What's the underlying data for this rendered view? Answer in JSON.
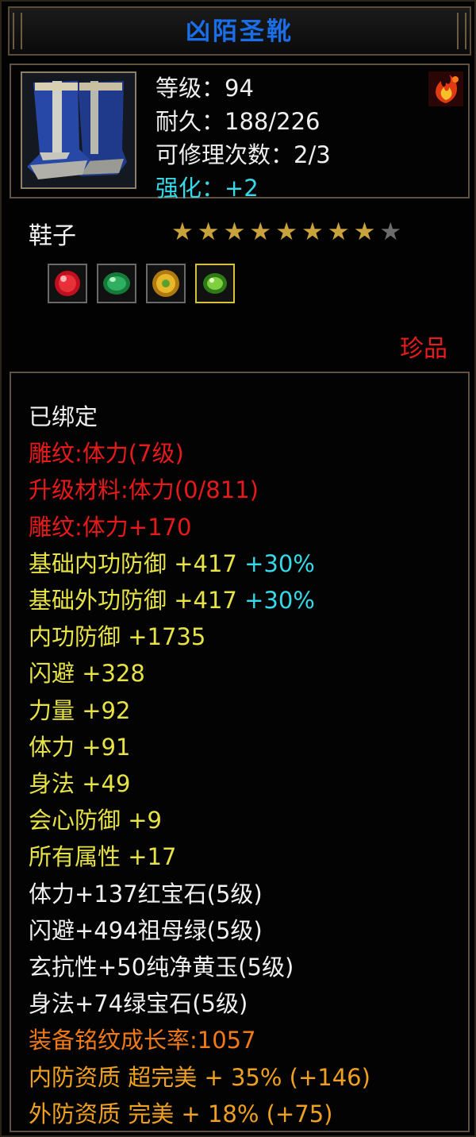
{
  "item": {
    "name": "凶陌圣靴",
    "level_text": "等级：94",
    "durability_text": "耐久：188/226",
    "repair_text": "可修理次数：2/3",
    "enhance_text": "强化：+2",
    "type": "鞋子",
    "stars": {
      "filled": 8,
      "total": 9
    },
    "rarity": "珍品",
    "gems": [
      {
        "name": "ruby-gem-icon",
        "color": "#e0202a"
      },
      {
        "name": "emerald-gem-icon",
        "color": "#25a050"
      },
      {
        "name": "yellow-jade-gem-icon",
        "color": "#d6a418"
      },
      {
        "name": "green-gem-icon",
        "color": "#6fd03a"
      }
    ]
  },
  "attributes": [
    {
      "segments": [
        {
          "text": "已绑定",
          "color": "white"
        }
      ]
    },
    {
      "segments": [
        {
          "text": "雕纹:体力(7级)",
          "color": "red"
        }
      ]
    },
    {
      "segments": [
        {
          "text": "升级材料:体力(0/811)",
          "color": "red"
        }
      ]
    },
    {
      "segments": [
        {
          "text": "雕纹:体力+170",
          "color": "red"
        }
      ]
    },
    {
      "segments": [
        {
          "text": "基础内功防御 +417 ",
          "color": "yellow"
        },
        {
          "text": "+30%",
          "color": "cyan"
        }
      ]
    },
    {
      "segments": [
        {
          "text": "基础外功防御 +417 ",
          "color": "yellow"
        },
        {
          "text": "+30%",
          "color": "cyan"
        }
      ]
    },
    {
      "segments": [
        {
          "text": "内功防御 +1735",
          "color": "yellow"
        }
      ]
    },
    {
      "segments": [
        {
          "text": "闪避 +328",
          "color": "yellow"
        }
      ]
    },
    {
      "segments": [
        {
          "text": "力量 +92",
          "color": "yellow"
        }
      ]
    },
    {
      "segments": [
        {
          "text": "体力 +91",
          "color": "yellow"
        }
      ]
    },
    {
      "segments": [
        {
          "text": "身法 +49",
          "color": "yellow"
        }
      ]
    },
    {
      "segments": [
        {
          "text": "会心防御 +9",
          "color": "yellow"
        }
      ]
    },
    {
      "segments": [
        {
          "text": "所有属性 +17",
          "color": "yellow"
        }
      ]
    },
    {
      "segments": [
        {
          "text": "体力+137红宝石(5级)",
          "color": "white"
        }
      ]
    },
    {
      "segments": [
        {
          "text": "闪避+494祖母绿(5级)",
          "color": "white"
        }
      ]
    },
    {
      "segments": [
        {
          "text": "玄抗性+50纯净黄玉(5级)",
          "color": "white"
        }
      ]
    },
    {
      "segments": [
        {
          "text": "身法+74绿宝石(5级)",
          "color": "white"
        }
      ]
    },
    {
      "segments": [
        {
          "text": "装备铭纹成长率:1057",
          "color": "orange"
        }
      ]
    },
    {
      "segments": [
        {
          "text": "内防资质 超完美 + 35% (+146)",
          "color": "gold"
        }
      ]
    },
    {
      "segments": [
        {
          "text": "外防资质 完美 + 18% (+75)",
          "color": "gold"
        }
      ]
    }
  ],
  "colors": {
    "title": "#1a6ee8",
    "star_filled": "#c9a23c",
    "star_empty": "#6c6c6c",
    "rarity": "#e81c1c"
  }
}
